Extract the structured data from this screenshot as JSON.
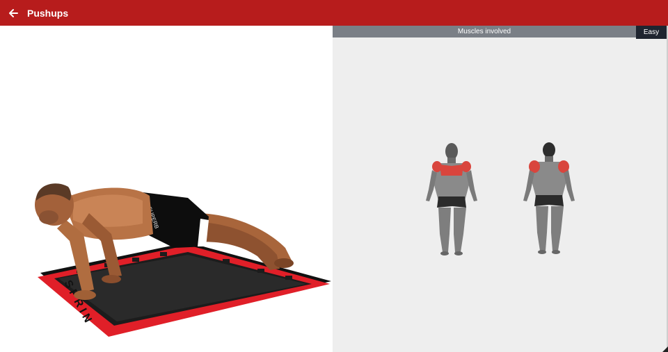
{
  "app_bar": {
    "title": "Pushups",
    "back_icon": "arrow-left-icon",
    "color": "#b71c1c"
  },
  "exercise_image": {
    "icon": "pushup-illustration",
    "mat_lettering": "S P R I N"
  },
  "muscles_panel": {
    "header": "Muscles involved",
    "difficulty": "Easy",
    "highlight_color": "#d9453d"
  }
}
